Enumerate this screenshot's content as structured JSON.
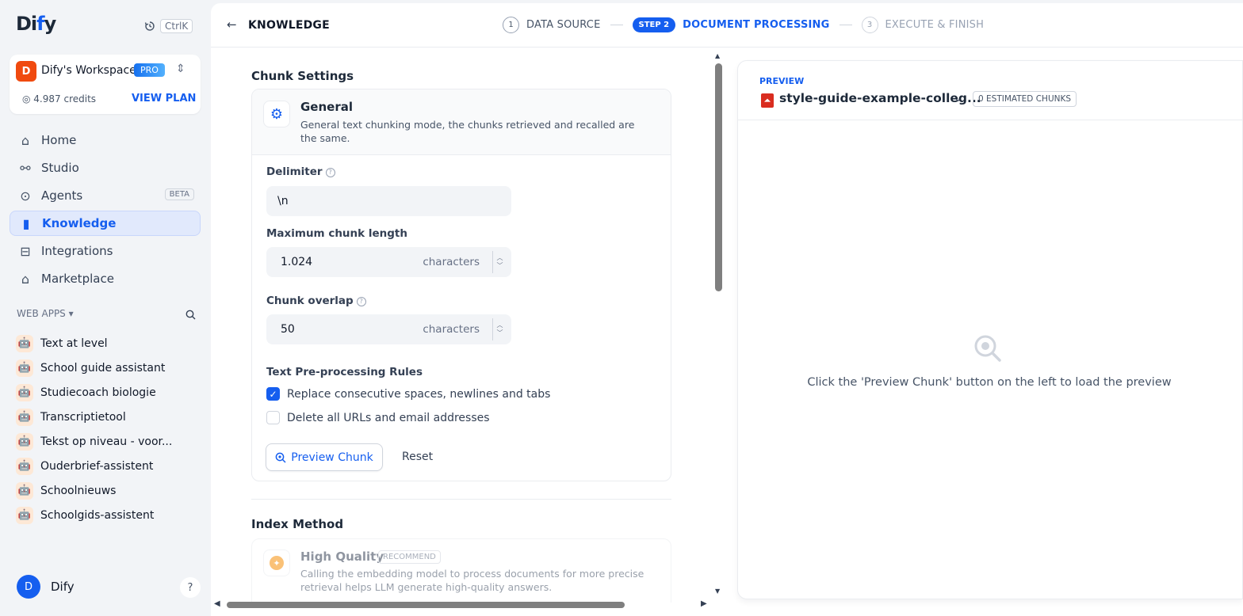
{
  "sidebar": {
    "logo_prefix": "Di",
    "logo_accent": "f",
    "logo_suffix": "y",
    "shortcut_key": "CtrlK",
    "workspace": {
      "avatar_letter": "D",
      "name": "Dify's Workspace",
      "plan_badge": "PRO",
      "credits": "4.987 credits",
      "view_plan": "VIEW PLAN"
    },
    "nav": [
      {
        "label": "Home",
        "icon": "home-icon"
      },
      {
        "label": "Studio",
        "icon": "studio-icon"
      },
      {
        "label": "Agents",
        "icon": "agents-icon",
        "badge": "BETA"
      },
      {
        "label": "Knowledge",
        "icon": "knowledge-icon",
        "active": true
      },
      {
        "label": "Integrations",
        "icon": "integrations-icon"
      },
      {
        "label": "Marketplace",
        "icon": "marketplace-icon"
      }
    ],
    "web_apps_label": "WEB APPS",
    "apps": [
      "Text at level",
      "School guide assistant",
      "Studiecoach biologie",
      "Transcriptietool",
      "Tekst op niveau - voor...",
      "Ouderbrief-assistent",
      "Schoolnieuws",
      "Schoolgids-assistent"
    ],
    "user": {
      "avatar_letter": "D",
      "name": "Dify",
      "help": "?"
    }
  },
  "header": {
    "title": "KNOWLEDGE",
    "steps": [
      {
        "num": "1",
        "label": "DATA SOURCE"
      },
      {
        "pill": "STEP 2",
        "label": "DOCUMENT PROCESSING"
      },
      {
        "num": "3",
        "label": "EXECUTE & FINISH"
      }
    ]
  },
  "chunk_settings": {
    "section_title": "Chunk Settings",
    "mode_name": "General",
    "mode_desc": "General text chunking mode, the chunks retrieved and recalled are the same.",
    "delimiter_label": "Delimiter",
    "delimiter_value": "\\n",
    "max_length_label": "Maximum chunk length",
    "max_length_value": "1.024",
    "max_length_unit": "characters",
    "overlap_label": "Chunk overlap",
    "overlap_value": "50",
    "overlap_unit": "characters",
    "rules_label": "Text Pre-processing Rules",
    "rule_1": "Replace consecutive spaces, newlines and tabs",
    "rule_1_checked": true,
    "rule_2": "Delete all URLs and email addresses",
    "rule_2_checked": false,
    "preview_button": "Preview Chunk",
    "reset_button": "Reset"
  },
  "index_method": {
    "section_title": "Index Method",
    "name": "High Quality",
    "badge": "RECOMMEND",
    "desc": "Calling the embedding model to process documents for more precise retrieval helps LLM generate high-quality answers."
  },
  "preview": {
    "tag": "PREVIEW",
    "doc_name": "style-guide-example-colleg...",
    "chunks_badge": "0 ESTIMATED CHUNKS",
    "empty_text": "Click the 'Preview Chunk' button on the left to load the preview"
  },
  "colors": {
    "accent": "#155eef",
    "workspace_avatar": "#f04a0f",
    "pdf_icon": "#d92d20"
  }
}
